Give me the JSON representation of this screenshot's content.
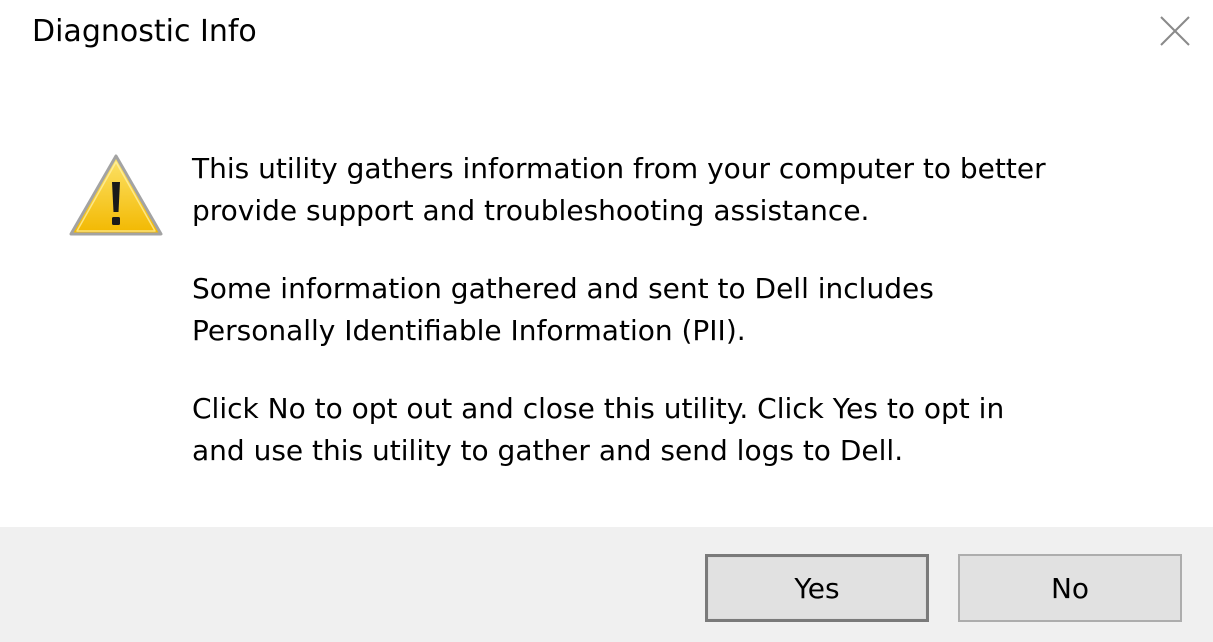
{
  "window": {
    "title": "Diagnostic Info",
    "close_icon": "close-icon"
  },
  "icon": {
    "name": "warning-icon",
    "color": "#f5c800"
  },
  "message": {
    "paragraph1": "This utility gathers information from your computer to better\nprovide support and troubleshooting assistance.",
    "paragraph2": "Some information gathered and sent to Dell includes\nPersonally Identifiable Information (PII).",
    "paragraph3": "Click No to opt out and close this utility. Click Yes to opt in\nand use this utility to gather and send logs to Dell."
  },
  "buttons": {
    "yes_label": "Yes",
    "no_label": "No",
    "default": "Yes"
  },
  "colors": {
    "footer_bg": "#f0f0f0",
    "button_bg": "#e1e1e1"
  }
}
